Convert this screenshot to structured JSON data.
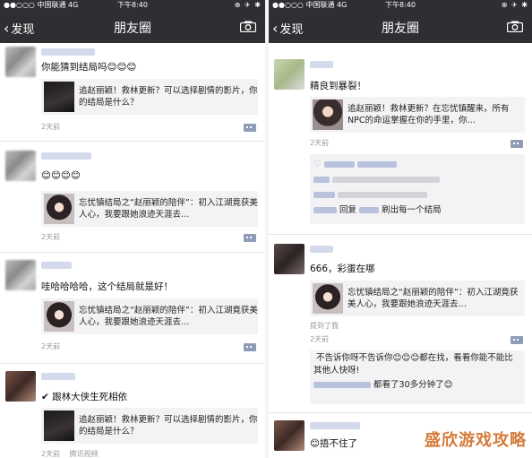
{
  "status": {
    "carrier": "中国联通",
    "network": "4G",
    "time": "下午8:40",
    "icons": "⊕ ✈ ✱"
  },
  "nav": {
    "back_label": "发现",
    "title": "朋友圈"
  },
  "left_posts": [
    {
      "text": "你能猜到结局吗😊😊😊",
      "card": "追赵丽颖！救林更新？可以选择剧情的影片，你的结局是什么？",
      "time": "2天前"
    },
    {
      "text": "😊😊😊😊",
      "card": "忘忧镇结局之“赵丽颖的陪伴”：初入江湖竟获美人心，我要跟她浪迹天涯去…",
      "time": "2天前"
    },
    {
      "text": "哇哈哈哈哈，这个结局就是好！",
      "card": "忘忧镇结局之“赵丽颖的陪伴”：初入江湖竟获美人心，我要跟她浪迹天涯去…",
      "time": "2天前"
    },
    {
      "text": "✔ 跟林大侠生死相依",
      "card": "追赵丽颖！救林更新？可以选择剧情的影片，你的结局是什么？",
      "time": "2天前",
      "source": "腾讯视频"
    }
  ],
  "right_posts": [
    {
      "text": "精良到暴裂！",
      "card": "追赵丽颖！救林更新？在忘忧镇醒来，所有NPC的命运掌握在你的手里，你…",
      "time": "2天前",
      "comments": {
        "reply_word": "回复",
        "reply_text": "刷出每一个结局"
      }
    },
    {
      "text": "666，彩蛋在哪",
      "card": "忘忧镇结局之“赵丽颖的陪伴”：初入江湖竟获美人心，我要跟她浪迹天涯去…",
      "mention": "提到了我",
      "time": "2天前",
      "comments": {
        "c1": "不告诉你呀不告诉你😊😊😊都在找，看看你能不能比其他人快呀!",
        "c2": "都看了30多分钟了😊"
      }
    },
    {
      "text": "😊捂不住了"
    }
  ],
  "watermark": "盛欣游戏攻略"
}
